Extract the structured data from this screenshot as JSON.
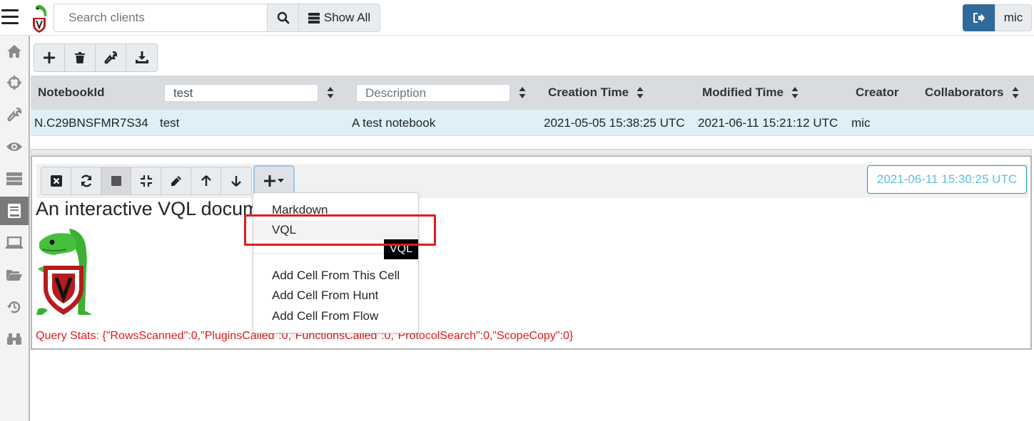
{
  "navbar": {
    "search_placeholder": "Search clients",
    "show_all_label": "Show All",
    "user_label": "mic"
  },
  "sidebar": {
    "items": [
      {
        "icon": "home-icon"
      },
      {
        "icon": "crosshairs-icon"
      },
      {
        "icon": "wrench-icon"
      },
      {
        "icon": "eye-icon"
      },
      {
        "icon": "server-icon"
      },
      {
        "icon": "book-icon",
        "active": true
      },
      {
        "icon": "laptop-icon"
      },
      {
        "icon": "folder-open-icon"
      },
      {
        "icon": "history-icon"
      },
      {
        "icon": "binoculars-icon"
      }
    ]
  },
  "notebook_toolbar": {
    "buttons": [
      "add-icon",
      "trash-icon",
      "wrench-icon",
      "download-icon"
    ]
  },
  "table": {
    "columns": {
      "notebook_id": "NotebookId",
      "creation_time": "Creation Time",
      "modified_time": "Modified Time",
      "creator": "Creator",
      "collaborators": "Collaborators"
    },
    "filters": {
      "name_value": "test",
      "description_placeholder": "Description"
    },
    "rows": [
      {
        "notebook_id": "N.C29BNSFMR7S34",
        "name": "test",
        "description": "A test notebook",
        "creation_time": "2021-05-05 15:38:25 UTC",
        "modified_time": "2021-06-11 15:21:12 UTC",
        "creator": "mic",
        "collaborators": ""
      }
    ]
  },
  "cell": {
    "timestamp": "2021-06-11 15:30:25 UTC",
    "heading": "An interactive VQL docum",
    "query_stats": "Query Stats: {\"RowsScanned\":0,\"PluginsCalled\":0,\"FunctionsCalled\":0,\"ProtocolSearch\":0,\"ScopeCopy\":0}"
  },
  "dropdown": {
    "items": [
      "Markdown",
      "VQL",
      "Add Cell From This Cell",
      "Add Cell From Hunt",
      "Add Cell From Flow"
    ],
    "tooltip": "VQL"
  },
  "colors": {
    "accent": "#2f6a9b",
    "highlight": "#e31b1b",
    "stats_text": "#e0191b",
    "timestamp_text": "#5bc0de"
  }
}
